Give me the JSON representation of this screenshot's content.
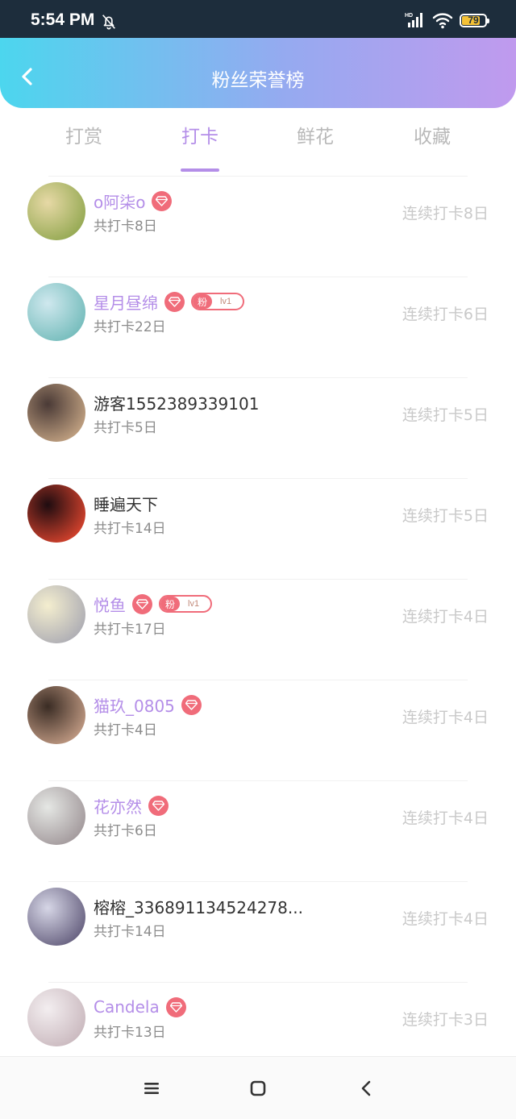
{
  "status_bar": {
    "time": "5:54 PM",
    "battery": "79",
    "battery_level": 0.79,
    "icons": [
      "bell-off-icon",
      "hd-signal-icon",
      "wifi-icon",
      "battery-icon"
    ]
  },
  "header": {
    "title": "粉丝荣誉榜",
    "back_icon": "chevron-left-icon"
  },
  "tabs": [
    {
      "label": "打赏",
      "active": false
    },
    {
      "label": "打卡",
      "active": true
    },
    {
      "label": "鲜花",
      "active": false
    },
    {
      "label": "收藏",
      "active": false
    }
  ],
  "list": [
    {
      "name": "o阿柒o",
      "vip": true,
      "fan_badge": false,
      "total": "共打卡8日",
      "streak": "连续打卡8日",
      "avatar_colors": [
        "#e7d9a6",
        "#8ea54c"
      ]
    },
    {
      "name": "星月昼绵",
      "vip": true,
      "fan_badge": true,
      "total": "共打卡22日",
      "streak": "连续打卡6日",
      "avatar_colors": [
        "#cfe8ee",
        "#6eb9b8"
      ]
    },
    {
      "name": "游客1552389339101",
      "vip": false,
      "fan_badge": false,
      "total": "共打卡5日",
      "streak": "连续打卡5日",
      "avatar_colors": [
        "#4a3a36",
        "#caa987"
      ]
    },
    {
      "name": "睡遍天下",
      "vip": false,
      "fan_badge": false,
      "total": "共打卡14日",
      "streak": "连续打卡5日",
      "avatar_colors": [
        "#1e0c10",
        "#e2462f"
      ]
    },
    {
      "name": "悦鱼",
      "vip": true,
      "fan_badge": true,
      "total": "共打卡17日",
      "streak": "连续打卡4日",
      "avatar_colors": [
        "#f4eecf",
        "#a8a8b2"
      ]
    },
    {
      "name": "猫玖_0805",
      "vip": true,
      "fan_badge": false,
      "total": "共打卡4日",
      "streak": "连续打卡4日",
      "avatar_colors": [
        "#3a2c24",
        "#c9a189"
      ]
    },
    {
      "name": "花亦然",
      "vip": true,
      "fan_badge": false,
      "total": "共打卡6日",
      "streak": "连续打卡4日",
      "avatar_colors": [
        "#e5e7e4",
        "#9d9396"
      ]
    },
    {
      "name": "榕榕_336891134524278...",
      "vip": false,
      "fan_badge": false,
      "total": "共打卡14日",
      "streak": "连续打卡4日",
      "avatar_colors": [
        "#d6d6e6",
        "#5f5878"
      ]
    },
    {
      "name": "Candela",
      "vip": true,
      "fan_badge": false,
      "total": "共打卡13日",
      "streak": "连续打卡3日",
      "avatar_colors": [
        "#f3eef0",
        "#c7b5bb"
      ]
    }
  ],
  "fan_badge": {
    "label": "粉",
    "level": "lv1"
  },
  "nav_bar": {
    "icons": [
      "menu-icon",
      "home-square-icon",
      "back-triangle-icon"
    ]
  }
}
